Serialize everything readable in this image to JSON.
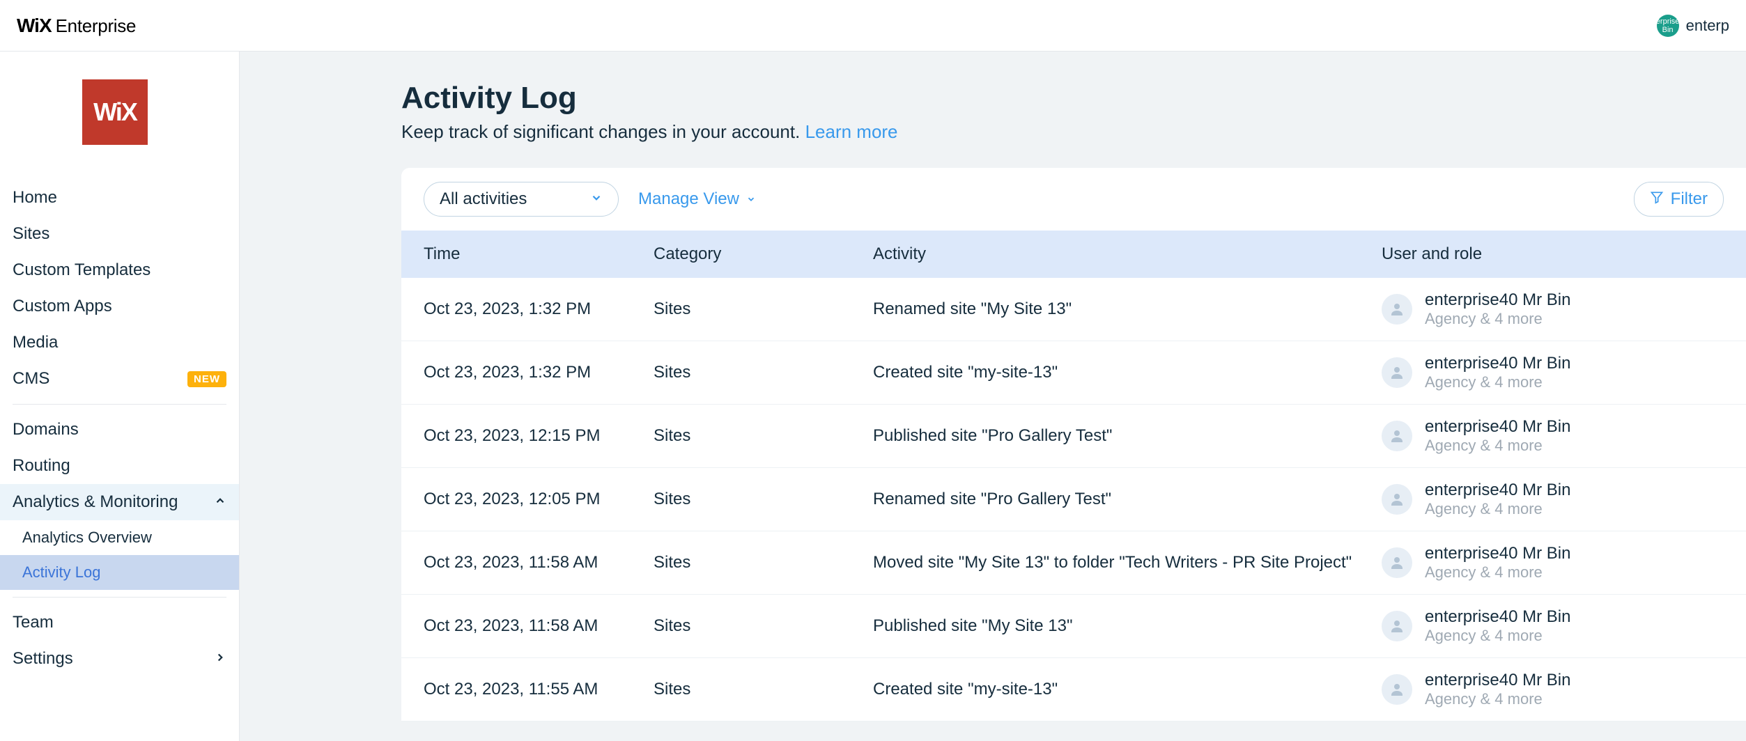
{
  "header": {
    "brand_wix": "WiX",
    "brand_enterprise": "Enterprise",
    "user_avatar_text": "erprise Bin",
    "user_name": "enterp"
  },
  "sidebar": {
    "logo": "WiX",
    "items": [
      {
        "label": "Home"
      },
      {
        "label": "Sites"
      },
      {
        "label": "Custom Templates"
      },
      {
        "label": "Custom Apps"
      },
      {
        "label": "Media"
      },
      {
        "label": "CMS",
        "badge": "NEW"
      }
    ],
    "items2": [
      {
        "label": "Domains"
      },
      {
        "label": "Routing"
      },
      {
        "label": "Analytics & Monitoring",
        "expand": true,
        "open": true
      },
      {
        "label": "Analytics Overview",
        "sub": true
      },
      {
        "label": "Activity Log",
        "sub": true,
        "active": true
      }
    ],
    "items3": [
      {
        "label": "Team"
      },
      {
        "label": "Settings",
        "expand": true
      }
    ]
  },
  "page": {
    "title": "Activity Log",
    "subtitle_prefix": "Keep track of significant changes in your account. ",
    "learn_more": "Learn more"
  },
  "toolbar": {
    "dropdown_label": "All activities",
    "manage_view": "Manage View",
    "filter": "Filter"
  },
  "table": {
    "head": {
      "time": "Time",
      "category": "Category",
      "activity": "Activity",
      "user": "User and role"
    },
    "rows": [
      {
        "time": "Oct 23, 2023, 1:32 PM",
        "category": "Sites",
        "activity": "Renamed site \"My Site 13\"",
        "user_name": "enterprise40 Mr Bin",
        "user_role": "Agency & 4 more"
      },
      {
        "time": "Oct 23, 2023, 1:32 PM",
        "category": "Sites",
        "activity": "Created site \"my-site-13\"",
        "user_name": "enterprise40 Mr Bin",
        "user_role": "Agency & 4 more"
      },
      {
        "time": "Oct 23, 2023, 12:15 PM",
        "category": "Sites",
        "activity": "Published site \"Pro Gallery Test\"",
        "user_name": "enterprise40 Mr Bin",
        "user_role": "Agency & 4 more"
      },
      {
        "time": "Oct 23, 2023, 12:05 PM",
        "category": "Sites",
        "activity": "Renamed site \"Pro Gallery Test\"",
        "user_name": "enterprise40 Mr Bin",
        "user_role": "Agency & 4 more"
      },
      {
        "time": "Oct 23, 2023, 11:58 AM",
        "category": "Sites",
        "activity": "Moved site \"My Site 13\" to folder \"Tech Writers - PR Site Project\"",
        "user_name": "enterprise40 Mr Bin",
        "user_role": "Agency & 4 more"
      },
      {
        "time": "Oct 23, 2023, 11:58 AM",
        "category": "Sites",
        "activity": "Published site \"My Site 13\"",
        "user_name": "enterprise40 Mr Bin",
        "user_role": "Agency & 4 more"
      },
      {
        "time": "Oct 23, 2023, 11:55 AM",
        "category": "Sites",
        "activity": "Created site \"my-site-13\"",
        "user_name": "enterprise40 Mr Bin",
        "user_role": "Agency & 4 more"
      }
    ]
  }
}
